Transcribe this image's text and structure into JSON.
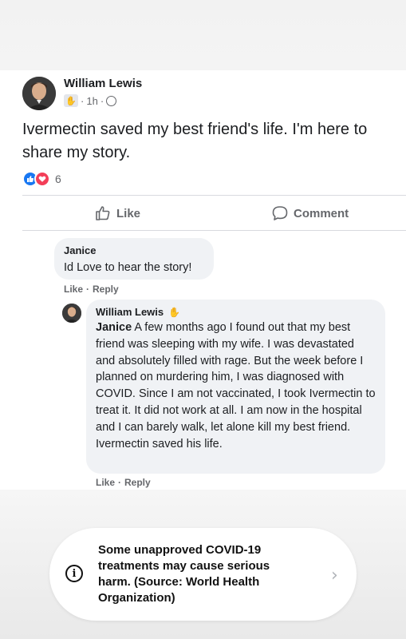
{
  "post": {
    "author": "William Lewis",
    "time": "1h",
    "text": "Ivermectin saved my best friend's life. I'm here to share my story.",
    "reaction_count": "6"
  },
  "actions": {
    "like_label": "Like",
    "comment_label": "Comment"
  },
  "comments": [
    {
      "author": "Janice",
      "text": "Id Love to hear the story!",
      "like_link": "Like",
      "separator": "·",
      "reply_link": "Reply"
    },
    {
      "author": "William Lewis",
      "mention": "Janice",
      "text": " A few months ago I found out that my best friend was sleeping with my wife. I was devastated and absolutely filled with rage. But the week before I planned on murdering him, I was diagnosed with COVID. Since I am not vaccinated, I took Ivermectin to treat it. It did not work at all. I am now in the hospital and I can barely walk, let alone kill my best friend. Ivermectin saved his life.",
      "like_link": "Like",
      "separator": "·",
      "reply_link": "Reply"
    }
  ],
  "notice": {
    "text": "Some unapproved COVID-19 treatments may cause serious harm. (Source: World Health Organization)",
    "icon": "info-icon",
    "chevron": "›"
  },
  "colors": {
    "like_blue": "#1877f2",
    "love_red": "#f33e58",
    "muted_text": "#65676b",
    "bubble_bg": "#f0f2f5"
  }
}
